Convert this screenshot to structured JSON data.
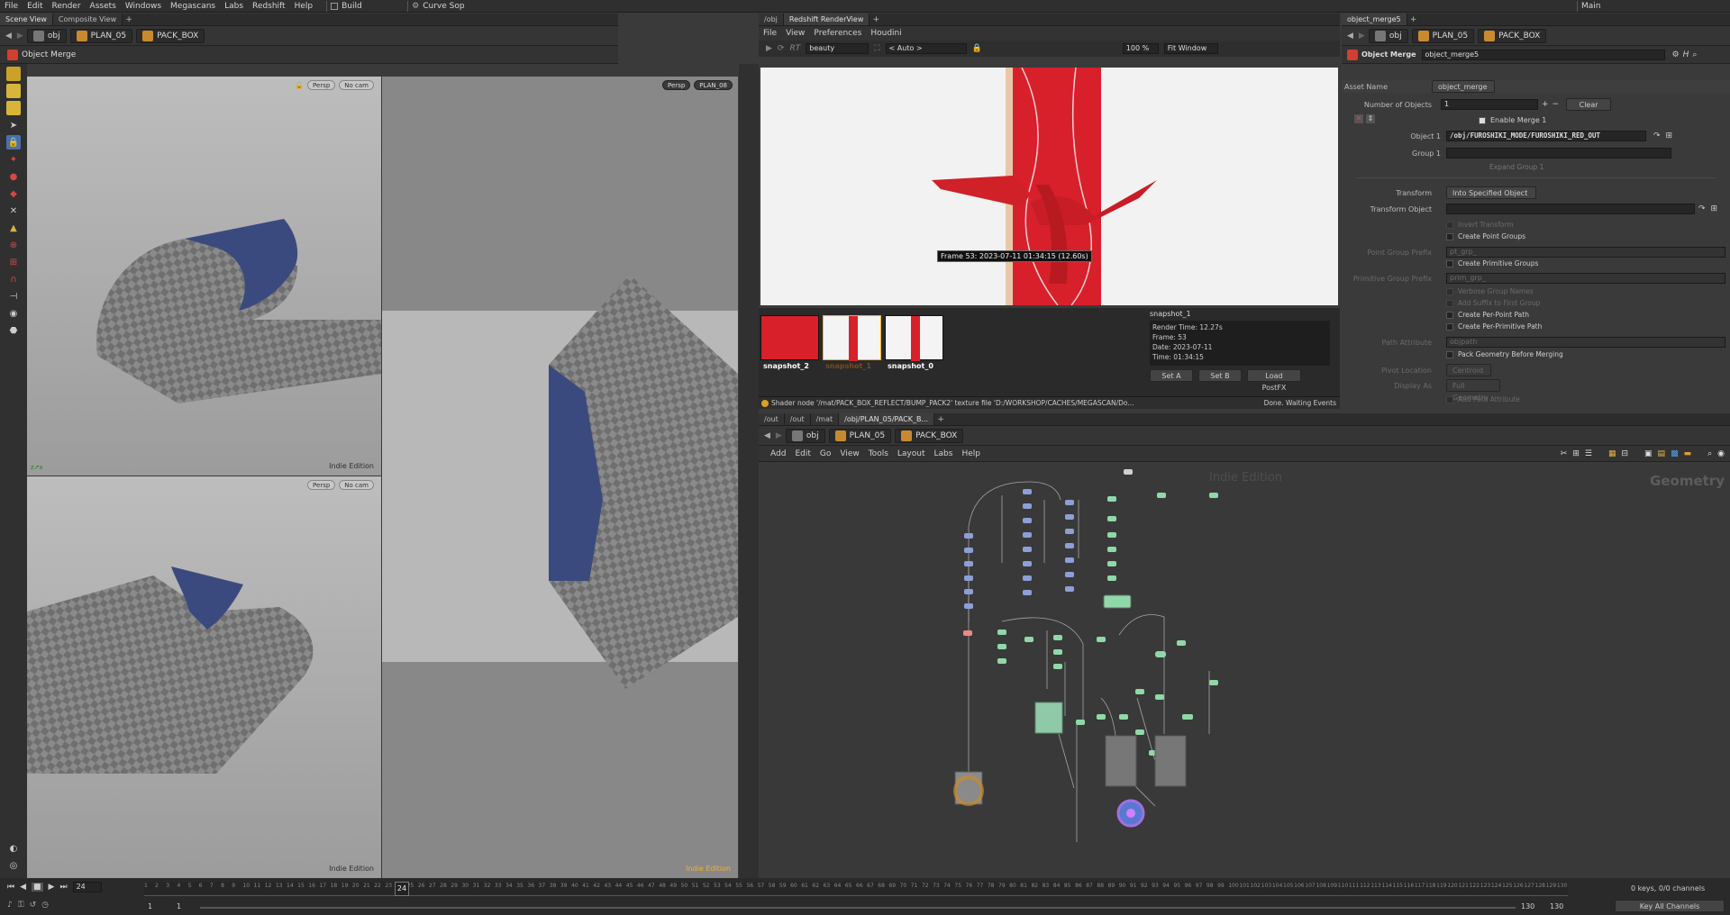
{
  "menubar": {
    "items": [
      "File",
      "Edit",
      "Render",
      "Assets",
      "Windows",
      "Megascans",
      "Labs",
      "Redshift",
      "Help"
    ],
    "desktop": "Build",
    "shelf": "Curve Sop",
    "workspace": "Main"
  },
  "scene": {
    "tabs": [
      "Scene View",
      "Composite View"
    ],
    "path": [
      "obj",
      "PLAN_05",
      "PACK_BOX"
    ],
    "tool_title": "Object Merge",
    "vp_top_left": {
      "persp": "Persp",
      "cam": "No cam",
      "edition": "Indie Edition"
    },
    "vp_bottom_left": {
      "persp": "Persp",
      "cam": "No cam",
      "edition": "Indie Edition"
    },
    "vp_right": {
      "persp": "Persp",
      "cam": "PLAN_08",
      "edition": "Indie Edition"
    }
  },
  "render": {
    "tabs": [
      "/obj",
      "Redshift RenderView"
    ],
    "menu": [
      "File",
      "View",
      "Preferences",
      "Houdini"
    ],
    "rt": "RT",
    "aov": "beauty",
    "camera": "< Auto >",
    "zoom": "100 %",
    "fit": "Fit Window",
    "frame_label": "Frame 53: 2023-07-11 01:34:15 (12.60s)",
    "snapshots": [
      "snapshot_2",
      "snapshot_1",
      "snapshot_0"
    ],
    "info": {
      "name": "snapshot_1",
      "render_time": "Render Time: 12.27s",
      "frame": "Frame: 53",
      "date": "Date: 2023-07-11",
      "time": "Time: 01:34:15"
    },
    "buttons": [
      "Set A",
      "Set B",
      "Load PostFX"
    ],
    "status": "Shader node '/mat/PACK_BOX_REFLECT/BUMP_PACK2' texture file 'D:/WORKSHOP/CACHES/MEGASCAN/Do...",
    "status_right": "Done. Waiting Events"
  },
  "params": {
    "tab": "object_merge5",
    "path": [
      "obj",
      "PLAN_05",
      "PACK_BOX"
    ],
    "node_type": "Object Merge",
    "node_name": "object_merge5",
    "asset_name_label": "Asset Name",
    "asset_name": "object_merge",
    "num_objects_label": "Number of Objects",
    "num_objects": "1",
    "clear": "Clear",
    "enable_merge": "Enable Merge 1",
    "object1_label": "Object 1",
    "object1": "/obj/FUROSHIKI_MODE/FUROSHIKI_RED_OUT",
    "group1_label": "Group 1",
    "expand_group": "Expand Group 1",
    "transform_label": "Transform",
    "transform": "Into Specified Object",
    "transform_object_label": "Transform Object",
    "invert_transform": "Invert Transform",
    "create_point_groups": "Create Point Groups",
    "point_group_prefix": "Point Group Prefix",
    "point_group_prefix_val": "pt_grp_",
    "create_primitive_groups": "Create Primitive Groups",
    "primitive_group_prefix": "Primitive Group Prefix",
    "primitive_group_prefix_val": "prim_grp_",
    "verbose": "Verbose Group Names",
    "add_suffix": "Add Suffix to First Group",
    "create_per_point": "Create Per-Point Path",
    "create_per_prim": "Create Per-Primitive Path",
    "path_attr": "Path Attribute",
    "path_attr_val": "objpath",
    "pack_geo": "Pack Geometry Before Merging",
    "pivot_label": "Pivot Location",
    "pivot": "Centroid",
    "display_label": "Display As",
    "display": "Full Geometry",
    "add_path_attr": "Add Path Attribute"
  },
  "network": {
    "tabs": [
      "/out",
      "/out",
      "/mat",
      "/obj/PLAN_05/PACK_B..."
    ],
    "path": [
      "obj",
      "PLAN_05",
      "PACK_BOX"
    ],
    "menu": [
      "Add",
      "Edit",
      "Go",
      "View",
      "Tools",
      "Layout",
      "Labs",
      "Help"
    ],
    "edition": "Indie Edition",
    "context": "Geometry"
  },
  "timeline": {
    "frame": "24",
    "start": "1",
    "start2": "1",
    "end": "130",
    "end2": "130",
    "keys": "0 keys, 0/0 channels",
    "key_all": "Key All Channels",
    "ticks": [
      "1",
      "2",
      "3",
      "4",
      "5",
      "6",
      "7",
      "8",
      "9",
      "10",
      "11",
      "12",
      "13",
      "14",
      "15",
      "16",
      "17",
      "18",
      "19",
      "20",
      "21",
      "22",
      "23",
      "24",
      "25",
      "26",
      "27",
      "28",
      "29",
      "30",
      "31",
      "32",
      "33",
      "34",
      "35",
      "36",
      "37",
      "38",
      "39",
      "40",
      "41",
      "42",
      "43",
      "44",
      "45",
      "46",
      "47",
      "48",
      "49",
      "50",
      "51",
      "52",
      "53",
      "54",
      "55",
      "56",
      "57",
      "58",
      "59",
      "60",
      "61",
      "62",
      "63",
      "64",
      "65",
      "66",
      "67",
      "68",
      "69",
      "70",
      "71",
      "72",
      "73",
      "74",
      "75",
      "76",
      "77",
      "78",
      "79",
      "80",
      "81",
      "82",
      "83",
      "84",
      "85",
      "86",
      "87",
      "88",
      "89",
      "90",
      "91",
      "92",
      "93",
      "94",
      "95",
      "96",
      "97",
      "98",
      "99",
      "100",
      "101",
      "102",
      "103",
      "104",
      "105",
      "106",
      "107",
      "108",
      "109",
      "110",
      "111",
      "112",
      "113",
      "114",
      "115",
      "116",
      "117",
      "118",
      "119",
      "120",
      "121",
      "122",
      "123",
      "124",
      "125",
      "126",
      "127",
      "128",
      "129",
      "130"
    ]
  },
  "colors": {
    "accent": "#ffb000",
    "selection": "#f0b030",
    "node_blue": "#8d9fd6",
    "node_green": "#8fd9a8",
    "cloth_blue": "#3b4a7e",
    "cloth_red": "#d8202b"
  }
}
